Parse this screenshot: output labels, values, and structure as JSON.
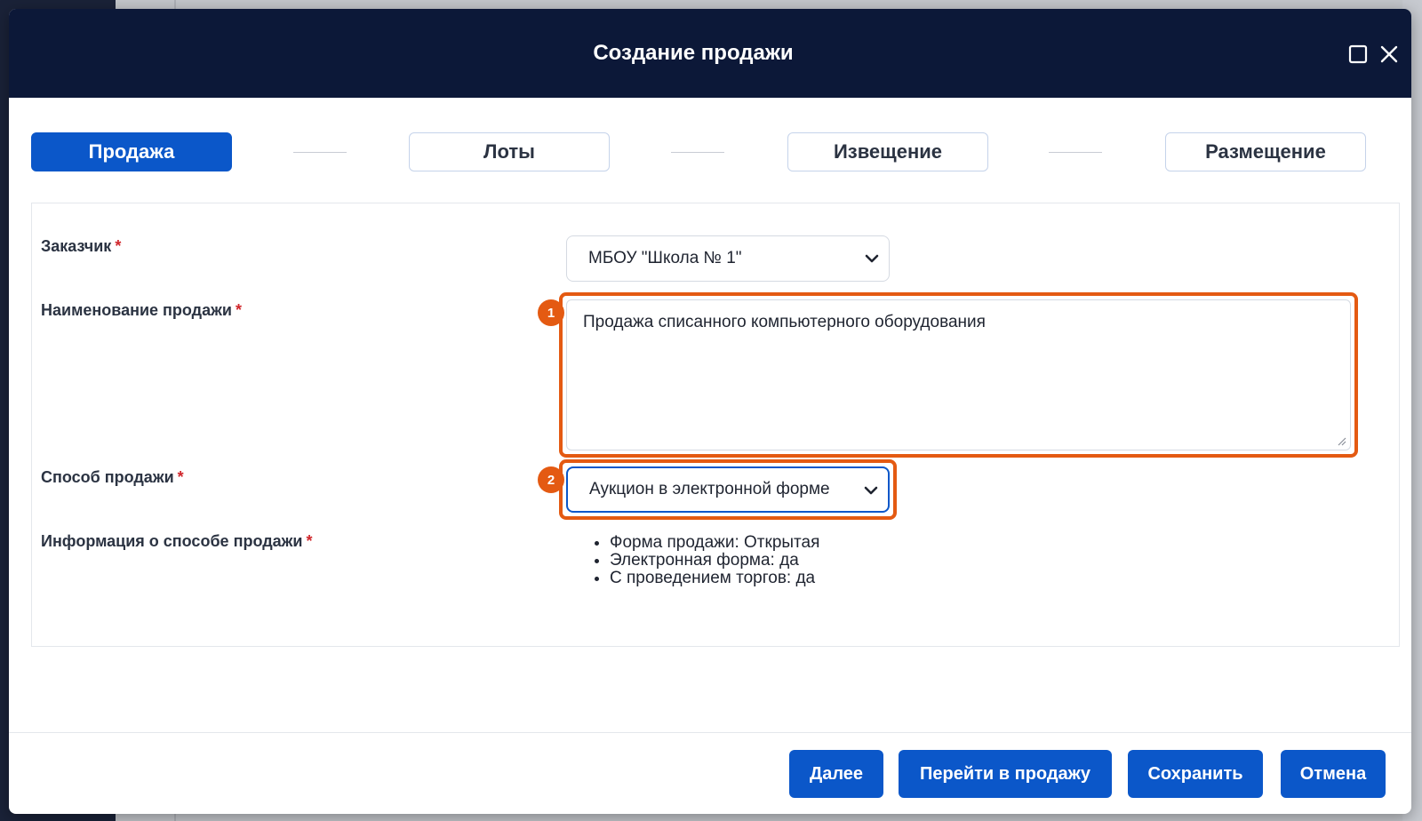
{
  "modal": {
    "title": "Создание продажи"
  },
  "steps": [
    {
      "label": "Продажа",
      "active": true
    },
    {
      "label": "Лоты",
      "active": false
    },
    {
      "label": "Извещение",
      "active": false
    },
    {
      "label": "Размещение",
      "active": false
    }
  ],
  "form": {
    "customer": {
      "label": "Заказчик",
      "required_mark": "*",
      "value": "МБОУ \"Школа № 1\""
    },
    "sale_name": {
      "label": "Наименование продажи",
      "required_mark": "*",
      "value": "Продажа списанного компьютерного оборудования",
      "marker": "1"
    },
    "sale_method": {
      "label": "Способ продажи",
      "required_mark": "*",
      "value": "Аукцион в электронной форме",
      "marker": "2"
    },
    "method_info": {
      "label": "Информация о способе продажи",
      "required_mark": "*",
      "items": [
        "Форма продажи: Открытая",
        "Электронная форма: да",
        "С проведением торгов: да"
      ]
    }
  },
  "footer": {
    "next_label": "Далее",
    "go_to_sale_label": "Перейти в продажу",
    "save_label": "Сохранить",
    "cancel_label": "Отмена"
  },
  "colors": {
    "header_bg": "#0c1838",
    "primary": "#0b57c9",
    "highlight": "#e45a12",
    "required": "#d0262b"
  },
  "icons": {
    "maximize": "square-maximize-icon",
    "close": "close-x-icon",
    "select_arrow": "chevron-down-icon",
    "resize": "resize-grip-icon"
  }
}
